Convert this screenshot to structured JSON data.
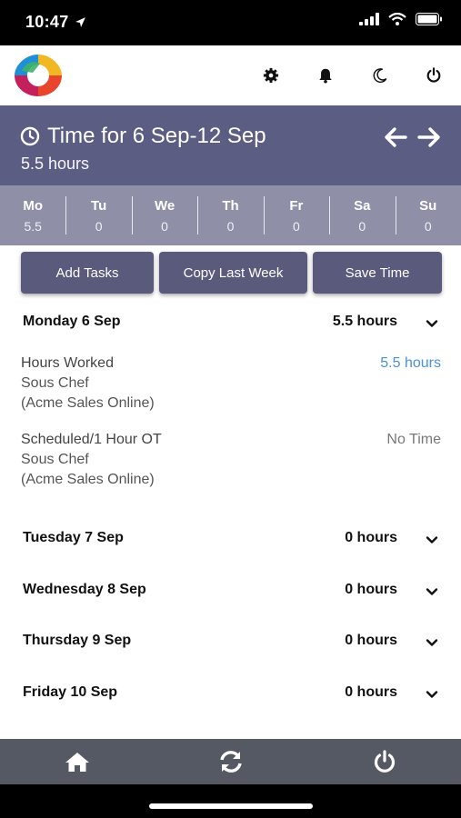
{
  "status_bar": {
    "time": "10:47"
  },
  "header": {
    "icons": [
      "gear-icon",
      "bell-icon",
      "moon-icon",
      "power-icon"
    ]
  },
  "banner": {
    "title": "Time for 6 Sep-12 Sep",
    "total": "5.5 hours"
  },
  "days": [
    {
      "name": "Mo",
      "value": "5.5"
    },
    {
      "name": "Tu",
      "value": "0"
    },
    {
      "name": "We",
      "value": "0"
    },
    {
      "name": "Th",
      "value": "0"
    },
    {
      "name": "Fr",
      "value": "0"
    },
    {
      "name": "Sa",
      "value": "0"
    },
    {
      "name": "Su",
      "value": "0"
    }
  ],
  "actions": {
    "add_tasks": "Add Tasks",
    "copy_last_week": "Copy Last Week",
    "save_time": "Save Time"
  },
  "day_rows": [
    {
      "label": "Monday 6 Sep",
      "hours": "5.5 hours",
      "entries": [
        {
          "title": "Hours Worked",
          "role": "Sous Chef",
          "company": "(Acme Sales Online)",
          "value": "5.5 hours"
        },
        {
          "title": "Scheduled/1 Hour OT",
          "role": "Sous Chef",
          "company": "(Acme Sales Online)",
          "value": "No Time"
        }
      ]
    },
    {
      "label": "Tuesday 7 Sep",
      "hours": "0 hours"
    },
    {
      "label": "Wednesday 8 Sep",
      "hours": "0 hours"
    },
    {
      "label": "Thursday 9 Sep",
      "hours": "0 hours"
    },
    {
      "label": "Friday 10 Sep",
      "hours": "0 hours"
    }
  ],
  "colors": {
    "banner": "#5c5d83",
    "day_strip": "#8f90a8",
    "button": "#5a5b7c",
    "link": "#4a90d9",
    "bottom_nav": "#555963"
  },
  "bottom_nav": [
    "home-icon",
    "sync-icon",
    "power-icon"
  ]
}
